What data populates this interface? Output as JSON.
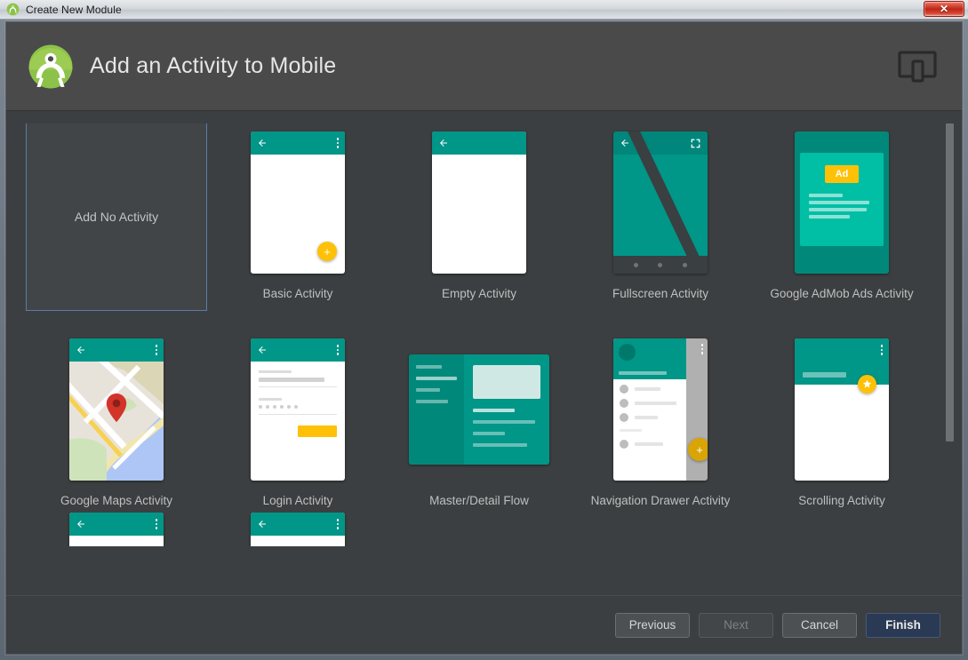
{
  "window": {
    "title": "Create New Module",
    "icon": "android-studio-icon",
    "close_label": "✕"
  },
  "header": {
    "title": "Add an Activity to Mobile",
    "logo": "android-studio-logo",
    "device_icon": "tablet-device-icon"
  },
  "colors": {
    "teal": "#009688",
    "teal_dark": "#00897b",
    "teal_light": "#00bfa5",
    "amber": "#ffc107",
    "selection_border": "#5c7ca8",
    "panel_bg": "#3c3f41",
    "header_bg": "#4a4a4a",
    "finish_bg": "#2b3a54"
  },
  "templates": [
    {
      "id": "no-activity",
      "label": "Add No Activity",
      "selected": true,
      "thumb": "none"
    },
    {
      "id": "basic-activity",
      "label": "Basic Activity",
      "selected": false,
      "thumb": "basic"
    },
    {
      "id": "empty-activity",
      "label": "Empty Activity",
      "selected": false,
      "thumb": "empty"
    },
    {
      "id": "fullscreen-activity",
      "label": "Fullscreen Activity",
      "selected": false,
      "thumb": "fullscreen"
    },
    {
      "id": "admob-activity",
      "label": "Google AdMob Ads Activity",
      "selected": false,
      "thumb": "admob",
      "badge": "Ad"
    },
    {
      "id": "maps-activity",
      "label": "Google Maps Activity",
      "selected": false,
      "thumb": "maps"
    },
    {
      "id": "login-activity",
      "label": "Login Activity",
      "selected": false,
      "thumb": "login"
    },
    {
      "id": "master-detail-flow",
      "label": "Master/Detail Flow",
      "selected": false,
      "thumb": "masterdetail"
    },
    {
      "id": "nav-drawer-activity",
      "label": "Navigation Drawer Activity",
      "selected": false,
      "thumb": "navdrawer"
    },
    {
      "id": "scrolling-activity",
      "label": "Scrolling Activity",
      "selected": false,
      "thumb": "scrolling"
    }
  ],
  "scrollbar": {
    "orientation": "vertical",
    "thumb_top_pct": 0,
    "thumb_height_pct": 70
  },
  "footer": {
    "buttons": [
      {
        "id": "previous",
        "label": "Previous",
        "state": "enabled"
      },
      {
        "id": "next",
        "label": "Next",
        "state": "disabled"
      },
      {
        "id": "cancel",
        "label": "Cancel",
        "state": "enabled"
      },
      {
        "id": "finish",
        "label": "Finish",
        "state": "default"
      }
    ]
  }
}
